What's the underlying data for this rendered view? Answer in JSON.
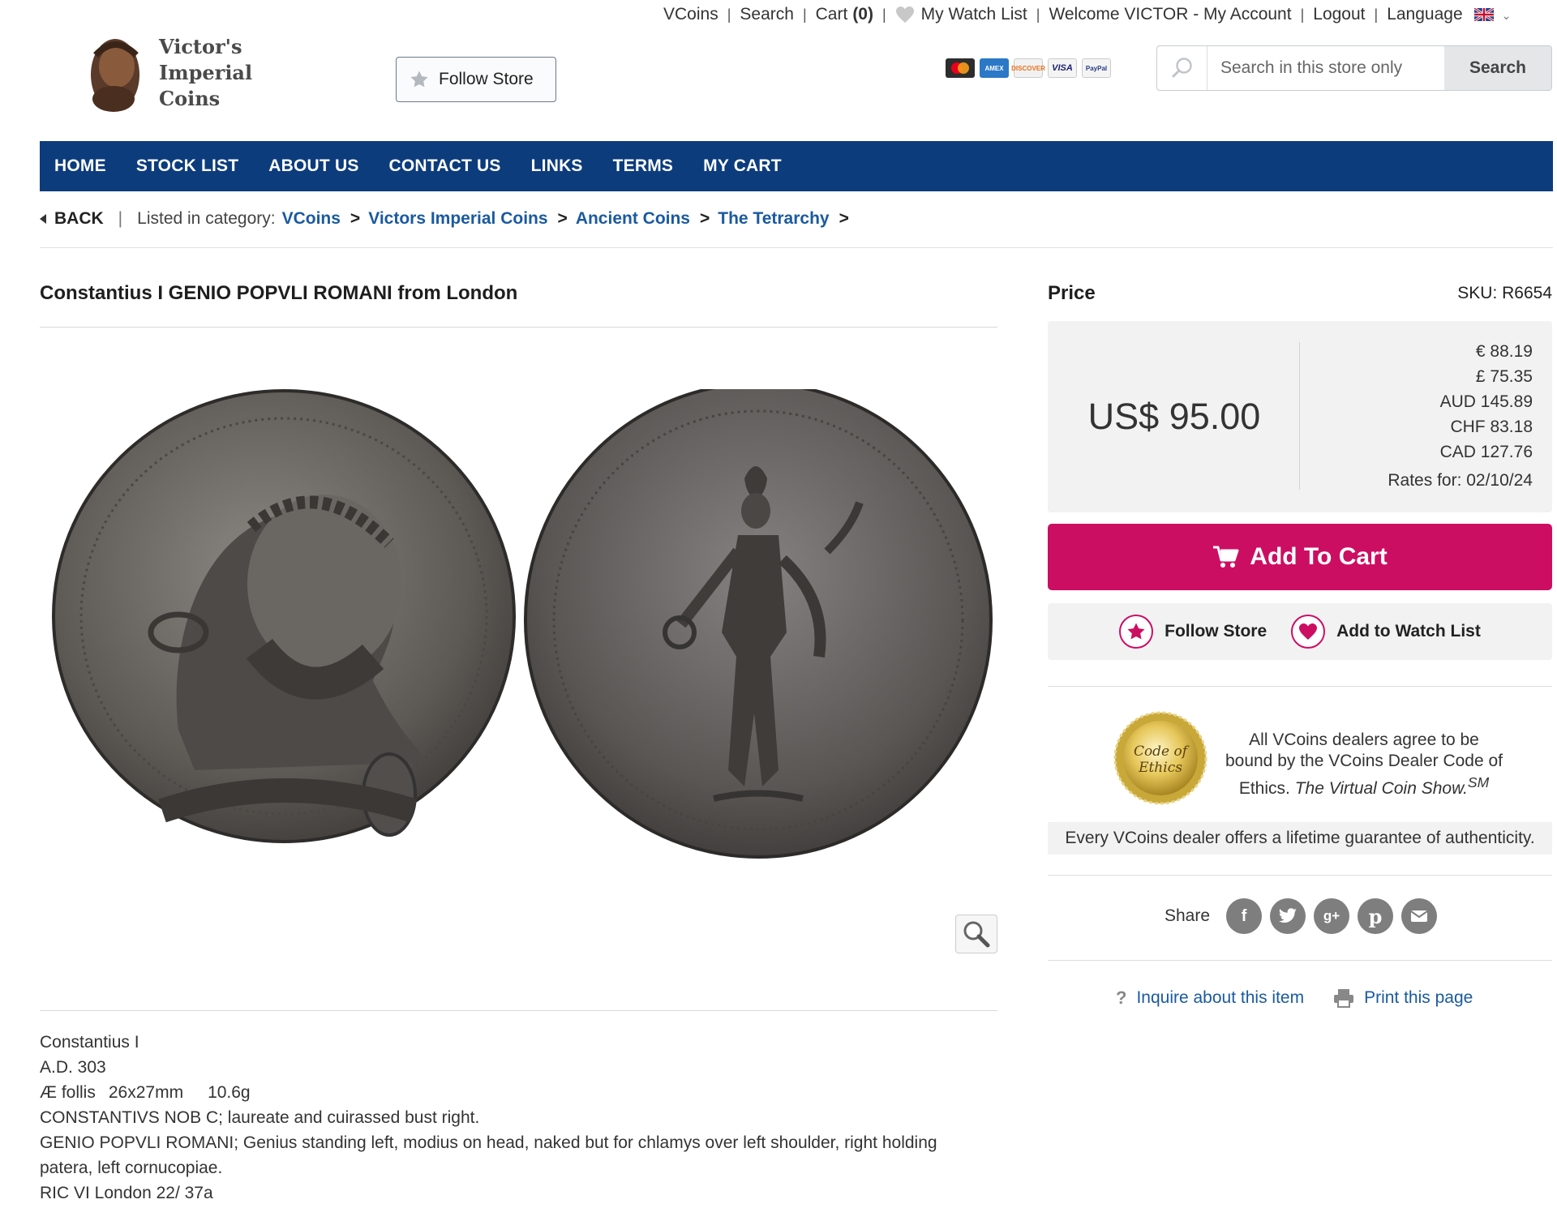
{
  "toplinks": {
    "vcoins": "VCoins",
    "search": "Search",
    "cart": "Cart",
    "cart_count": "(0)",
    "watchlist": "My Watch List",
    "welcome": "Welcome VICTOR - My Account",
    "logout": "Logout",
    "language": "Language"
  },
  "logo": {
    "line1": "Victor's",
    "line2": "Imperial",
    "line3": "Coins"
  },
  "follow_store_top": "Follow Store",
  "payment_cards": [
    "MasterCard",
    "AMEX",
    "DISCOVER",
    "VISA",
    "PayPal"
  ],
  "search": {
    "placeholder": "Search in this store only",
    "button": "Search"
  },
  "nav": [
    "HOME",
    "STOCK LIST",
    "ABOUT US",
    "CONTACT US",
    "LINKS",
    "TERMS",
    "MY CART"
  ],
  "breadcrumb": {
    "back": "BACK",
    "listed": "Listed in category:",
    "items": [
      "VCoins",
      "Victors Imperial Coins",
      "Ancient Coins",
      "The Tetrarchy"
    ]
  },
  "item": {
    "title": "Constantius I GENIO POPVLI ROMANI from London",
    "description": [
      "Constantius I",
      "A.D. 303",
      "Æ follis",
      "26x27mm",
      "10.6g",
      "CONSTANTIVS NOB C; laureate and cuirassed bust right.",
      "GENIO POPVLI ROMANI; Genius standing left, modius on head, naked but for chlamys over left shoulder, right holding patera, left cornucopiae.",
      "RIC VI London 22/ 37a"
    ]
  },
  "price": {
    "label": "Price",
    "sku": "SKU: R6654",
    "main": "US$ 95.00",
    "conversions": [
      "€ 88.19",
      "£ 75.35",
      "AUD 145.89",
      "CHF 83.18",
      "CAD 127.76"
    ],
    "rates": "Rates for: 02/10/24"
  },
  "actions": {
    "add_to_cart": "Add To Cart",
    "follow_store": "Follow Store",
    "add_watch": "Add to Watch List"
  },
  "ethics": {
    "seal_line1": "Code of",
    "seal_line2": "Ethics",
    "text1": "All VCoins dealers agree to be bound by the VCoins Dealer Code of Ethics.",
    "text_italic": "The Virtual Coin Show.",
    "sup": "SM",
    "guarantee": "Every VCoins dealer offers a lifetime guarantee of authenticity."
  },
  "share": {
    "label": "Share",
    "icons": [
      "facebook-icon",
      "twitter-icon",
      "google-plus-icon",
      "pinterest-icon",
      "email-icon"
    ]
  },
  "footer_links": {
    "inquire": "Inquire about this item",
    "print": "Print this page"
  },
  "colors": {
    "nav": "#0c3c7c",
    "accent": "#cc0e63",
    "link": "#1a5aa0"
  }
}
